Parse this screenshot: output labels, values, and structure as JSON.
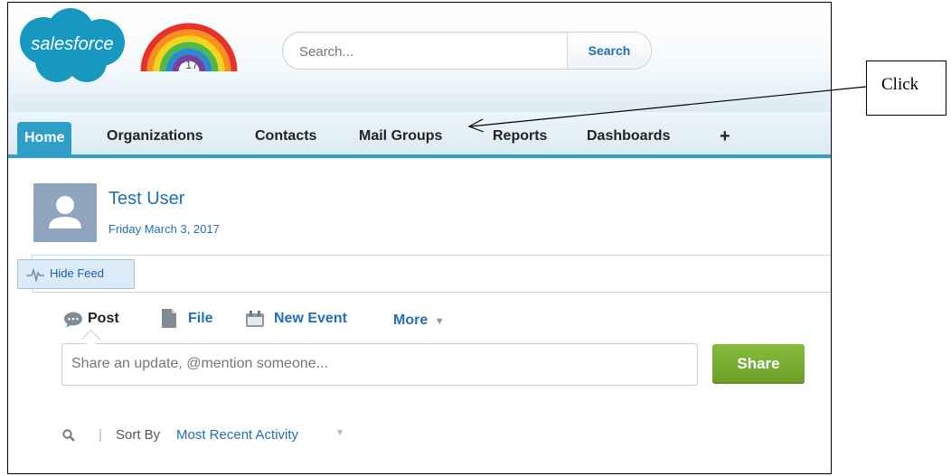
{
  "header": {
    "logo_text": "salesforce",
    "rainbow_badge": "'17",
    "search_placeholder": "Search...",
    "search_button": "Search"
  },
  "tabs": [
    {
      "label": "Home",
      "active": true
    },
    {
      "label": "Organizations"
    },
    {
      "label": "Contacts"
    },
    {
      "label": "Mail Groups"
    },
    {
      "label": "Reports"
    },
    {
      "label": "Dashboards"
    },
    {
      "label": "+"
    }
  ],
  "profile": {
    "name": "Test User",
    "date": "Friday March 3, 2017"
  },
  "feed": {
    "hide_feed_label": "Hide Feed"
  },
  "publisher": {
    "post": "Post",
    "file": "File",
    "new_event": "New Event",
    "more": "More",
    "share_placeholder": "Share an update, @mention someone...",
    "share_button": "Share"
  },
  "sort": {
    "separator": "|",
    "label": "Sort By",
    "value": "Most Recent Activity"
  },
  "callout": {
    "text": "Click"
  },
  "colors": {
    "accent": "#2f9ec9",
    "link": "#1f6fb4",
    "share_green": "#77ad33"
  }
}
